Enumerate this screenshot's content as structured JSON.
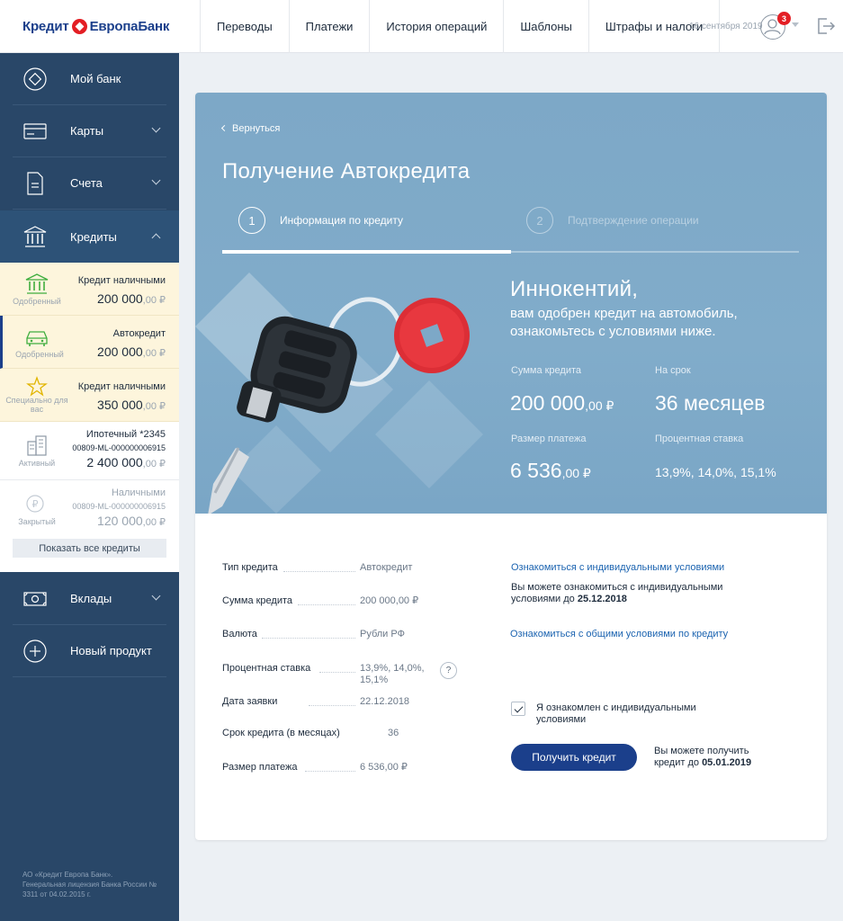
{
  "header": {
    "logo_left": "Кредит",
    "logo_right": "ЕвропаБанк",
    "nav": [
      "Переводы",
      "Платежи",
      "История операций",
      "Шаблоны",
      "Штрафы и налоги"
    ],
    "date": "16 сентября 2019",
    "notifications": "3",
    "icons": {
      "avatar": "user-icon",
      "logout": "logout-icon"
    }
  },
  "sidebar": {
    "items": [
      {
        "label": "Мой банк",
        "icon": "home-icon"
      },
      {
        "label": "Карты",
        "icon": "card-icon"
      },
      {
        "label": "Счета",
        "icon": "document-icon"
      },
      {
        "label": "Кредиты",
        "icon": "bank-icon"
      },
      {
        "label": "Вклады",
        "icon": "cash-icon"
      },
      {
        "label": "Новый продукт",
        "icon": "plus-icon"
      }
    ],
    "credits": [
      {
        "status": "Одобренный",
        "name": "Кредит наличными",
        "account": "",
        "amount": "200 000",
        "decimals": ",00 ₽",
        "icon": "bank-icon"
      },
      {
        "status": "Одобренный",
        "name": "Автокредит",
        "account": "",
        "amount": "200 000",
        "decimals": ",00 ₽",
        "icon": "car-icon"
      },
      {
        "status": "Специально для вас",
        "name": "Кредит наличными",
        "account": "",
        "amount": "350 000",
        "decimals": ",00 ₽",
        "icon": "star-icon"
      },
      {
        "status": "Активный",
        "name": "Ипотечный *2345",
        "account": "00809-ML-000000006915",
        "amount": "2 400 000",
        "decimals": ",00 ₽",
        "icon": "building-icon"
      },
      {
        "status": "Закрытый",
        "name": "Наличными",
        "account": "00809-ML-000000006915",
        "amount": "120 000",
        "decimals": ",00 ₽",
        "icon": "coin-icon"
      }
    ],
    "show_all": "Показать все кредиты",
    "legal": "АО «Кредит Европа Банк». Генеральная лицензия Банка России № 3311 от 04.02.2015 г."
  },
  "hero": {
    "back": "Вернуться",
    "title": "Получение Автокредита",
    "steps": [
      {
        "num": "1",
        "label": "Информация по кредиту",
        "active": true
      },
      {
        "num": "2",
        "label": "Подтверждение операции",
        "active": false
      }
    ],
    "progress": 0.5,
    "greeting_name": "Иннокентий,",
    "greeting_line1": "вам одобрен кредит на автомобиль,",
    "greeting_line2": "ознакомьтесь с условиями ниже.",
    "sum_label": "Сумма кредита",
    "sum_value": "200 000",
    "sum_dec": ",00 ₽",
    "term_label": "На срок",
    "term_value": "36 месяцев",
    "payment_label": "Размер платежа",
    "payment_value": "6 536",
    "payment_dec": ",00 ₽",
    "rate_label": "Процентная ставка",
    "rate_value": "13,9%, 14,0%, 15,1%"
  },
  "details": [
    {
      "key": "Тип кредита",
      "value": "Автокредит"
    },
    {
      "key": "Сумма кредита",
      "value": "200 000,00 ₽"
    },
    {
      "key": "Валюта",
      "value": "Рубли РФ"
    },
    {
      "key": "Процентная ставка",
      "value": "13,9%, 14,0%, 15,1%"
    },
    {
      "key": "Дата заявки",
      "value": "22.12.2018"
    },
    {
      "key": "Срок кредита (в месяцах)",
      "value": "36"
    },
    {
      "key": "Размер платежа",
      "value": "6 536,00 ₽"
    }
  ],
  "help": "?",
  "side": {
    "link1": "Ознакомиться с индивидуальными условиями",
    "note1_a": "Вы можете ознакомиться с индивидуальными",
    "note1_b": "условиями до",
    "note1_date": "25.12.2018",
    "link2": "Ознакомиться с общими условиями по кредиту",
    "checkbox_a": "Я ознакомлен с индивидуальными",
    "checkbox_b": "условиями",
    "checkbox_checked": true,
    "button": "Получить кредит",
    "note2_a": "Вы можете получить",
    "note2_b": "кредит до",
    "note2_date": "05.01.2019"
  },
  "colors": {
    "brand": "#1b3f8b",
    "accent_red": "#e31e24",
    "sidebar": "#294768",
    "hero": "#7da8c7"
  }
}
